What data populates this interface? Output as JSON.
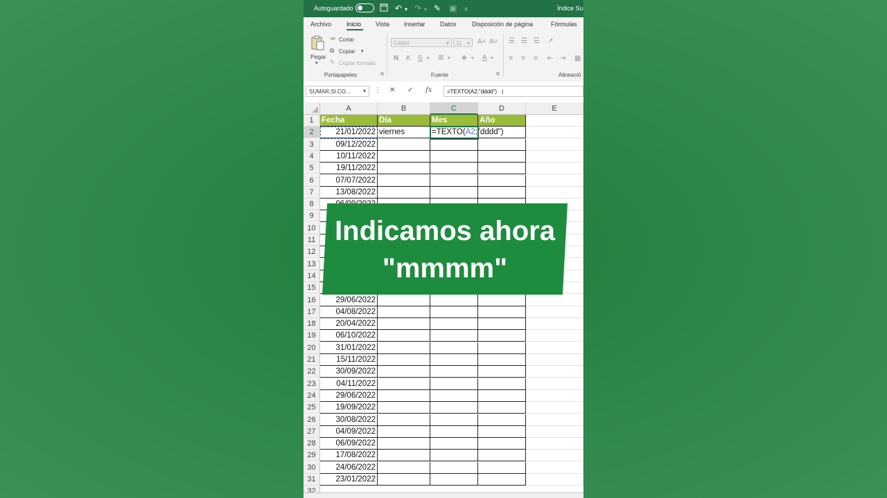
{
  "titlebar": {
    "autosave_label": "Autoguardado",
    "document_title": "Índice Sup",
    "icons": [
      "save-icon",
      "undo-icon",
      "redo-icon",
      "brush-icon",
      "customize-icon"
    ]
  },
  "menu_tabs": [
    "Archivo",
    "Inicio",
    "Vista",
    "Insertar",
    "Datos",
    "Disposición de página",
    "Fórmulas"
  ],
  "active_tab": "Inicio",
  "ribbon": {
    "clipboard": {
      "paste": "Pegar",
      "cut": "Cortar",
      "copy": "Copiar",
      "copy_format": "Copiar formato",
      "group_label": "Portapapeles"
    },
    "font": {
      "font_name": "Calibri",
      "font_size": "11",
      "group_label": "Fuente"
    },
    "alignment": {
      "group_label": "Alineació"
    }
  },
  "formula_bar": {
    "name_box": "SUMAR.SI.CO...",
    "formula": "=TEXTO(A2;\"dddd\")"
  },
  "columns": [
    "A",
    "B",
    "C",
    "D",
    "E"
  ],
  "rows": [
    "1",
    "2",
    "3",
    "4",
    "5",
    "6",
    "7",
    "8",
    "9",
    "10",
    "11",
    "12",
    "13",
    "14",
    "15",
    "16",
    "17",
    "18",
    "19",
    "20",
    "21",
    "22",
    "23",
    "24",
    "25",
    "26",
    "27",
    "28",
    "29",
    "30",
    "31",
    "32"
  ],
  "headers": [
    "Fecha",
    "Día",
    "Mes",
    "Año"
  ],
  "editing_cell": {
    "ref": "C2",
    "prefix": "=TEXTO(",
    "ref_text": "A2",
    "suffix": ";\"dddd\")"
  },
  "colors": {
    "excel_green": "#217346",
    "header_fill": "#9bbb3a",
    "banner_fill": "#1e8c3e",
    "reference_blue": "#4472c4"
  },
  "cells": {
    "A2": "21/01/2022",
    "B2": "viernes",
    "A3": "09/12/2022",
    "A4": "10/11/2022",
    "A5": "19/11/2022",
    "A6": "07/07/2022",
    "A7": "13/08/2022",
    "A8": "06/09/2022",
    "A16": "29/06/2022",
    "A17": "04/08/2022",
    "A18": "20/04/2022",
    "A19": "06/10/2022",
    "A20": "31/01/2022",
    "A21": "15/11/2022",
    "A22": "30/09/2022",
    "A23": "04/11/2022",
    "A24": "29/06/2022",
    "A25": "19/09/2022",
    "A26": "30/08/2022",
    "A27": "04/09/2022",
    "A28": "06/09/2022",
    "A29": "17/08/2022",
    "A30": "24/06/2022",
    "A31": "23/01/2022"
  },
  "caption": {
    "line1": "Indicamos ahora",
    "line2": "\"mmmm\""
  }
}
